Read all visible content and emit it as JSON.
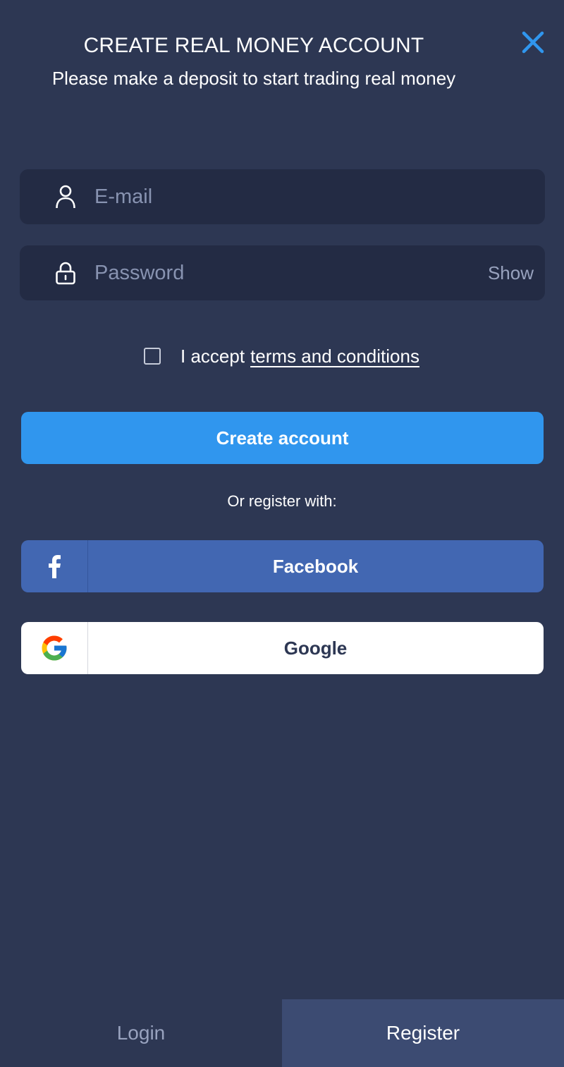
{
  "header": {
    "title": "CREATE REAL MONEY ACCOUNT",
    "subtitle": "Please make a deposit to start trading real money",
    "close_icon": "close-icon"
  },
  "form": {
    "email": {
      "placeholder": "E-mail",
      "value": "",
      "icon": "user-icon"
    },
    "password": {
      "placeholder": "Password",
      "value": "",
      "icon": "lock-icon",
      "show_label": "Show"
    },
    "terms": {
      "checked": false,
      "prefix": "I accept",
      "link_text": "terms and conditions"
    },
    "submit_label": "Create account"
  },
  "social": {
    "divider_text": "Or register with:",
    "facebook_label": "Facebook",
    "google_label": "Google"
  },
  "tabs": {
    "login": "Login",
    "register": "Register",
    "active": "register"
  },
  "colors": {
    "background": "#2d3753",
    "field_bg": "#232b44",
    "accent": "#3096ee",
    "facebook": "#4267b2",
    "active_tab": "#3c4b72"
  }
}
